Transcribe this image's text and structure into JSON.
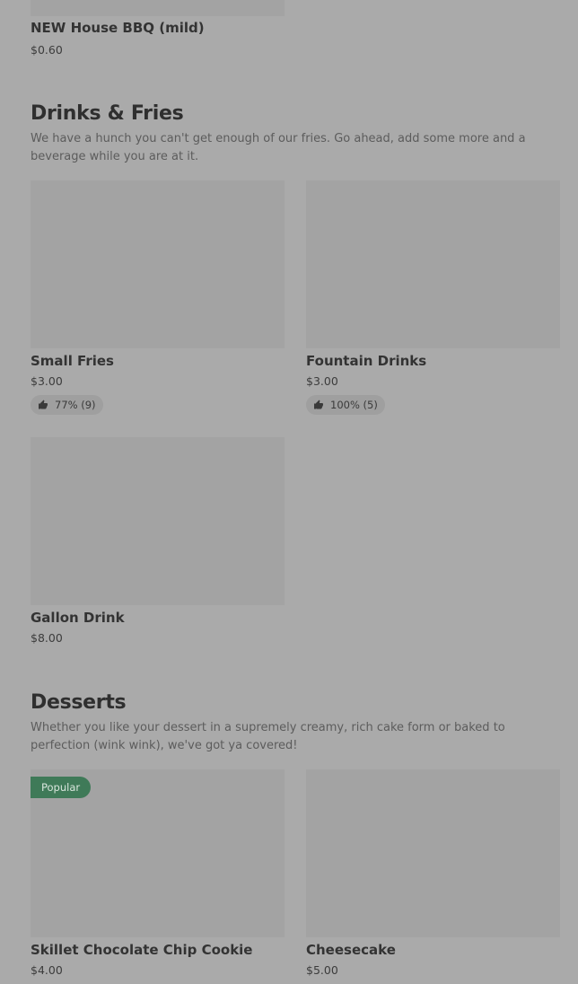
{
  "top_item": {
    "name": "NEW House BBQ (mild)",
    "price": "$0.60"
  },
  "drinks_section": {
    "title": "Drinks & Fries",
    "description": "We have a hunch you can't get enough of our fries. Go ahead, add some more and a beverage while you are at it.",
    "items": [
      {
        "name": "Small Fries",
        "price": "$3.00",
        "rating": "77% (9)"
      },
      {
        "name": "Fountain Drinks",
        "price": "$3.00",
        "rating": "100% (5)"
      },
      {
        "name": "Gallon Drink",
        "price": "$8.00"
      }
    ]
  },
  "desserts_section": {
    "title": "Desserts",
    "description": "Whether you like your dessert in a supremely creamy, rich cake form or baked to perfection (wink wink), we've got ya covered!",
    "items": [
      {
        "name": "Skillet Chocolate Chip Cookie",
        "price": "$4.00",
        "badge": "Popular"
      },
      {
        "name": "Cheesecake",
        "price": "$5.00"
      }
    ]
  },
  "icons": {
    "rating": "thumbs-up-icon"
  }
}
